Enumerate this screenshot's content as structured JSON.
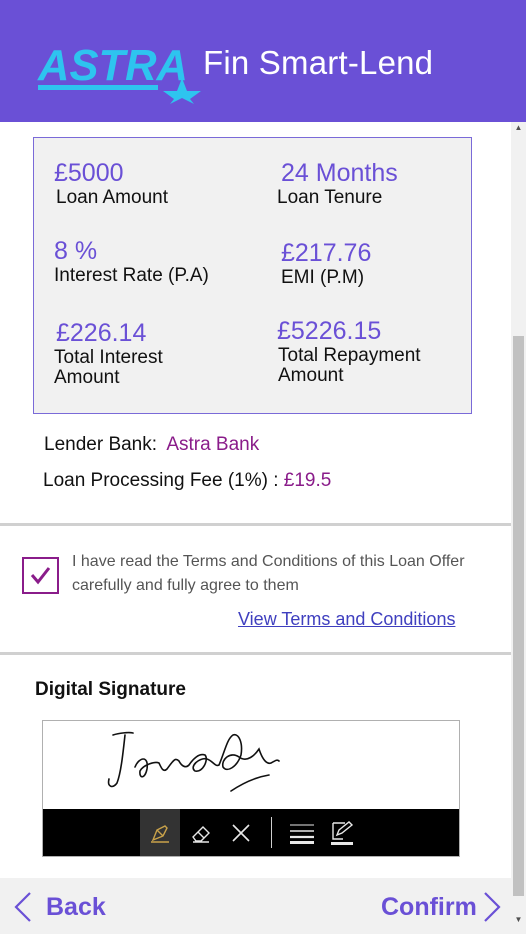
{
  "header": {
    "logo_text": "ASTRA",
    "title": "Fin Smart-Lend"
  },
  "summary": {
    "loan_amount": {
      "value": "£5000",
      "label": "Loan Amount"
    },
    "loan_tenure": {
      "value": "24 Months",
      "label": "Loan Tenure"
    },
    "interest_rate": {
      "value": "8 %",
      "label": "Interest Rate (P.A)"
    },
    "emi": {
      "value": "£217.76",
      "label": "EMI (P.M)"
    },
    "total_interest": {
      "value": "£226.14",
      "label_line1": "Total Interest",
      "label_line2": "Amount"
    },
    "total_repayment": {
      "value": "£5226.15",
      "label_line1": "Total Repayment",
      "label_line2": "Amount"
    }
  },
  "lender": {
    "label": "Lender Bank:",
    "value": "Astra Bank"
  },
  "processing_fee": {
    "label": "Loan Processing Fee (1%) :",
    "value": "£19.5"
  },
  "terms": {
    "checked": true,
    "text": "I have read the Terms and Conditions of this Loan Offer carefully and fully agree to them",
    "link": "View Terms and Conditions"
  },
  "signature": {
    "title": "Digital Signature",
    "tools": [
      "pen-icon",
      "eraser-icon",
      "clear-icon",
      "line-weight-icon",
      "pen-color-icon"
    ]
  },
  "footer": {
    "back_label": "Back",
    "confirm_label": "Confirm"
  },
  "colors": {
    "header_bg": "#6a50d6",
    "logo": "#2ec4ef",
    "accent_purple": "#6a50d6",
    "accent_magenta": "#8a1c8a",
    "link": "#3f3fbf"
  }
}
